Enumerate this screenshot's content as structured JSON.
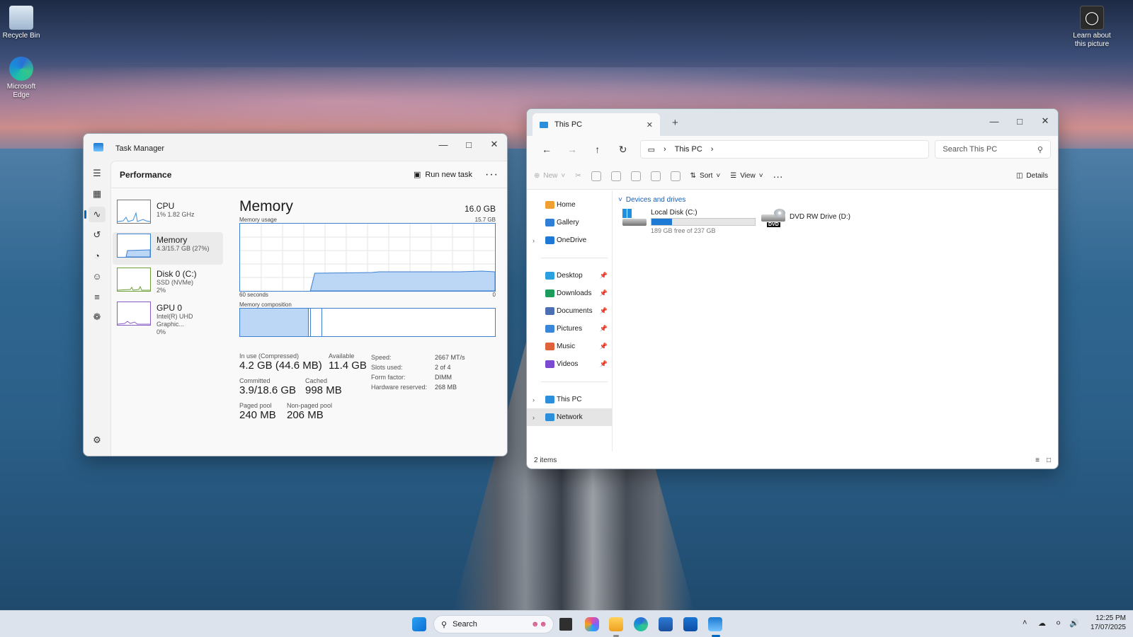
{
  "desktop": {
    "icons": [
      {
        "label": "Recycle Bin"
      },
      {
        "label": "Microsoft Edge"
      }
    ],
    "learn_about": "Learn about this picture"
  },
  "task_manager": {
    "title": "Task Manager",
    "section": "Performance",
    "run_new_task": "Run new task",
    "perf_items": [
      {
        "name": "CPU",
        "sub1": "1% 1.82 GHz",
        "sub2": ""
      },
      {
        "name": "Memory",
        "sub1": "4.3/15.7 GB (27%)",
        "sub2": ""
      },
      {
        "name": "Disk 0 (C:)",
        "sub1": "SSD (NVMe)",
        "sub2": "2%"
      },
      {
        "name": "GPU 0",
        "sub1": "Intel(R) UHD Graphic...",
        "sub2": "0%"
      }
    ],
    "detail": {
      "title": "Memory",
      "total": "16.0 GB",
      "usage_label": "Memory usage",
      "usage_max": "15.7 GB",
      "time_label": "60 seconds",
      "time_zero": "0",
      "composition_label": "Memory composition",
      "usage_fraction": 0.27,
      "stats": {
        "in_use_label": "In use (Compressed)",
        "in_use_value": "4.2 GB (44.6 MB)",
        "available_label": "Available",
        "available_value": "11.4 GB",
        "committed_label": "Committed",
        "committed_value": "3.9/18.6 GB",
        "cached_label": "Cached",
        "cached_value": "998 MB",
        "paged_label": "Paged pool",
        "paged_value": "240 MB",
        "nonpaged_label": "Non-paged pool",
        "nonpaged_value": "206 MB"
      },
      "specs": [
        {
          "k": "Speed:",
          "v": "2667 MT/s"
        },
        {
          "k": "Slots used:",
          "v": "2 of 4"
        },
        {
          "k": "Form factor:",
          "v": "DIMM"
        },
        {
          "k": "Hardware reserved:",
          "v": "268 MB"
        }
      ]
    }
  },
  "explorer": {
    "tab_title": "This PC",
    "address": "This PC",
    "search_placeholder": "Search This PC",
    "commands": {
      "new": "New",
      "sort": "Sort",
      "view": "View",
      "details": "Details"
    },
    "sidebar": [
      {
        "label": "Home",
        "color": "#f0a030"
      },
      {
        "label": "Gallery",
        "color": "#2f7fd6"
      },
      {
        "label": "OneDrive",
        "color": "#1e78d6"
      },
      {
        "label": "Desktop",
        "color": "#2aa0e0"
      },
      {
        "label": "Downloads",
        "color": "#1b9c5b"
      },
      {
        "label": "Documents",
        "color": "#4a6fb3"
      },
      {
        "label": "Pictures",
        "color": "#3a86d8"
      },
      {
        "label": "Music",
        "color": "#e0623a"
      },
      {
        "label": "Videos",
        "color": "#7a4bd0"
      },
      {
        "label": "This PC",
        "color": "#2b8fdb"
      },
      {
        "label": "Network",
        "color": "#2b8fdb"
      }
    ],
    "group": "Devices and drives",
    "drives": [
      {
        "name": "Local Disk (C:)",
        "free": "189 GB free of 237 GB",
        "used_fraction": 0.2
      },
      {
        "name": "DVD RW Drive (D:)",
        "badge": "DVD"
      }
    ],
    "status": "2 items"
  },
  "taskbar": {
    "search": "Search",
    "time": "12:25 PM",
    "date": "17/07/2025"
  }
}
